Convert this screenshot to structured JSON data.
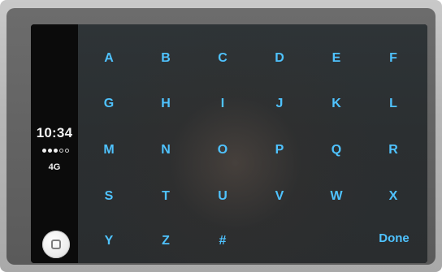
{
  "status_bar": {
    "time": "10:34",
    "signal": {
      "filled": 3,
      "total": 5
    },
    "network": "4G"
  },
  "home_button": {
    "icon": "home-square-icon"
  },
  "keyboard": {
    "keys": [
      "A",
      "B",
      "C",
      "D",
      "E",
      "F",
      "G",
      "H",
      "I",
      "J",
      "K",
      "L",
      "M",
      "N",
      "O",
      "P",
      "Q",
      "R",
      "S",
      "T",
      "U",
      "V",
      "W",
      "X",
      "Y",
      "Z",
      "#"
    ],
    "done_label": "Done",
    "key_color": "#4fc3ff"
  }
}
